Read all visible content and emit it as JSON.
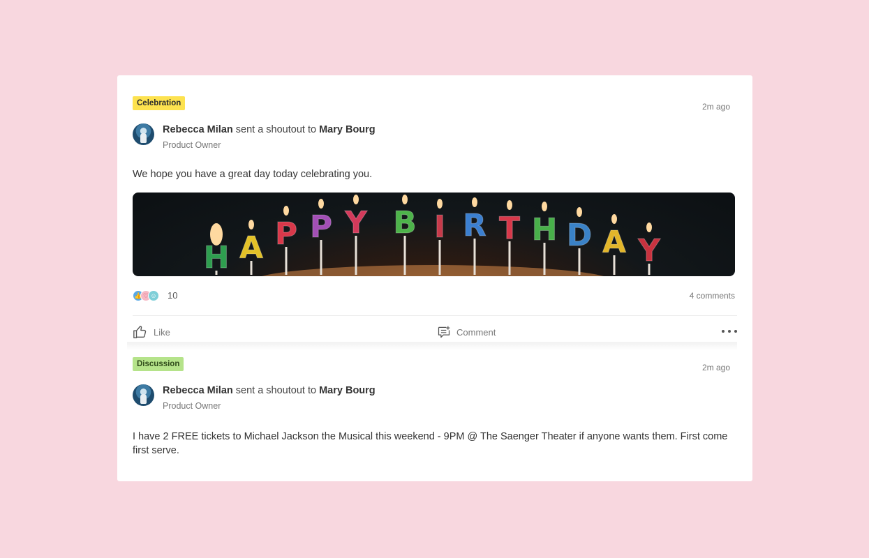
{
  "posts": [
    {
      "tag": "Celebration",
      "time": "2m ago",
      "author": "Rebecca Milan",
      "action": " sent a shoutout to ",
      "recipient": "Mary Bourg",
      "role": "Product Owner",
      "message": "We hope you have a great day today celebrating you.",
      "banner_letters": [
        "H",
        "A",
        "P",
        "P",
        "Y",
        "B",
        "I",
        "R",
        "T",
        "H",
        "D",
        "A",
        "Y"
      ],
      "reaction_count": "10",
      "comments": "4 comments",
      "like_label": "Like",
      "comment_label": "Comment"
    },
    {
      "tag": "Discussion",
      "time": "2m ago",
      "author": "Rebecca Milan",
      "action": " sent a shoutout to ",
      "recipient": "Mary Bourg",
      "role": "Product Owner",
      "message": "I have 2 FREE tickets to Michael Jackson the Musical this weekend - 9PM @ The Saenger Theater if anyone wants them. First come first serve."
    }
  ],
  "colors": {
    "background": "#f8d7df",
    "celebration_tag": "#fde24f",
    "discussion_tag": "#b5e38a",
    "candle_colors": [
      "#2e9e4f",
      "#e3c228",
      "#d8384a",
      "#a24fb5",
      "#d33a5b",
      "#4db34a",
      "#c73a4a",
      "#3b7fd0",
      "#d8384a",
      "#48b04a",
      "#3a82c7",
      "#e3b62a",
      "#c8323f"
    ]
  },
  "icons": {
    "like": "thumbs-up-icon",
    "comment": "comment-icon",
    "more": "more-dots-icon"
  }
}
